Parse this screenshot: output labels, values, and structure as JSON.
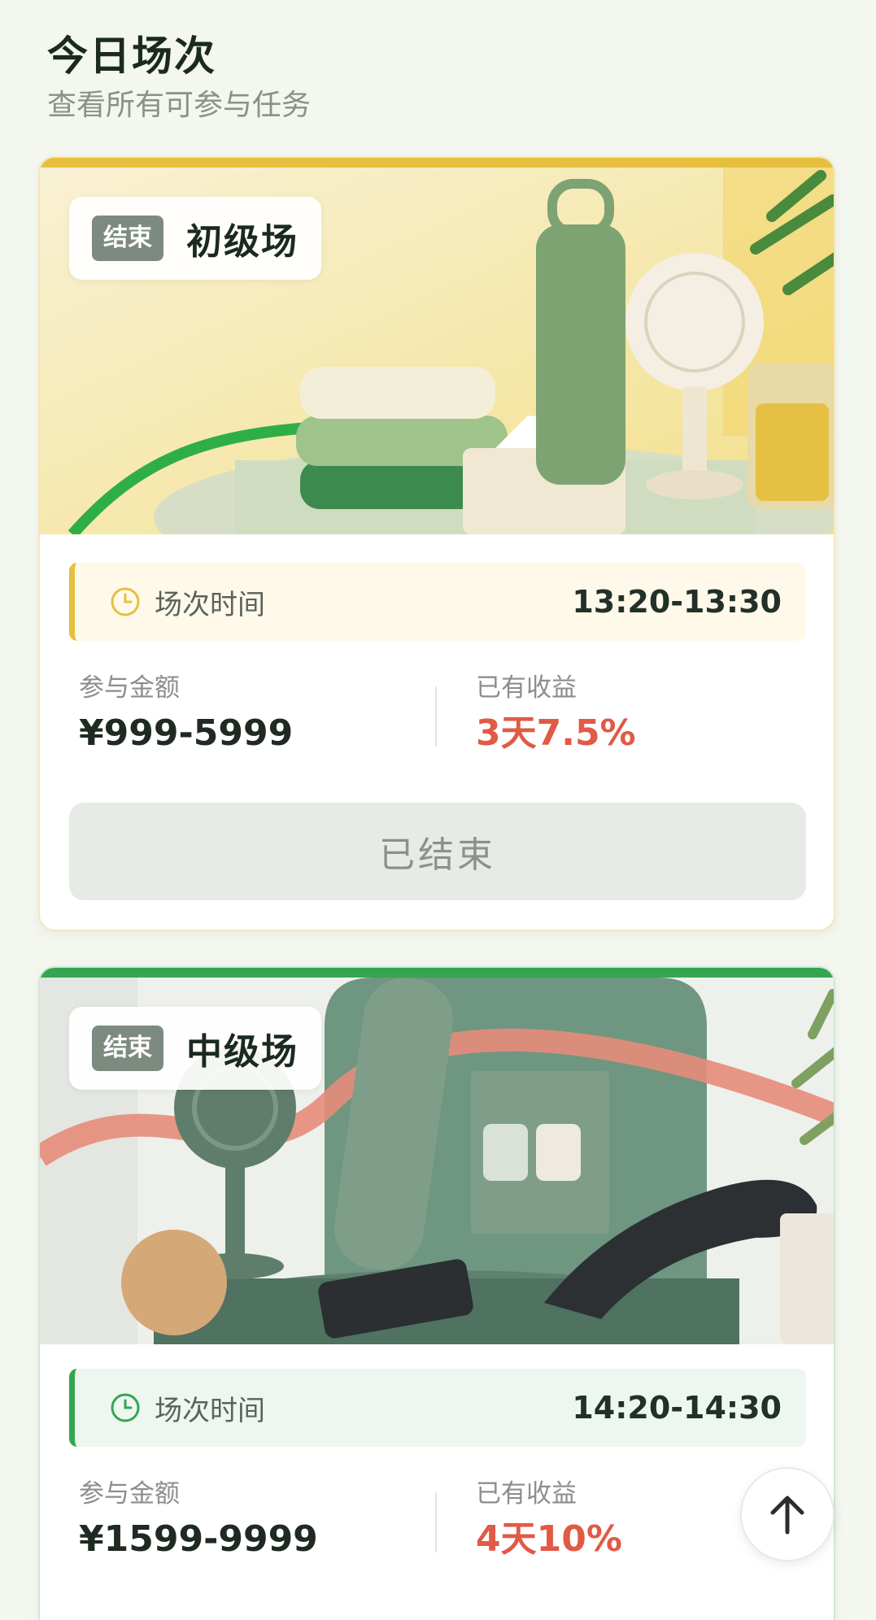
{
  "header": {
    "title": "今日场次",
    "subtitle": "查看所有可参与任务"
  },
  "sessions": [
    {
      "status": "结束",
      "name": "初级场",
      "time_label": "场次时间",
      "time": "13:20-13:30",
      "amount_label": "参与金额",
      "amount": "¥999-5999",
      "yield_label": "已有收益",
      "yield": "3天7.5%",
      "button": "已结束",
      "accent": "#e6bf3e"
    },
    {
      "status": "结束",
      "name": "中级场",
      "time_label": "场次时间",
      "time": "14:20-14:30",
      "amount_label": "参与金额",
      "amount": "¥1599-9999",
      "yield_label": "已有收益",
      "yield": "4天10%",
      "accent": "#35a552"
    }
  ],
  "colors": {
    "background": "#f3f7f0",
    "highlight_red": "#e05a45",
    "status_badge": "#7d8a80"
  },
  "icons": {
    "clock": "clock-icon",
    "scroll_top": "arrow-up-icon"
  }
}
